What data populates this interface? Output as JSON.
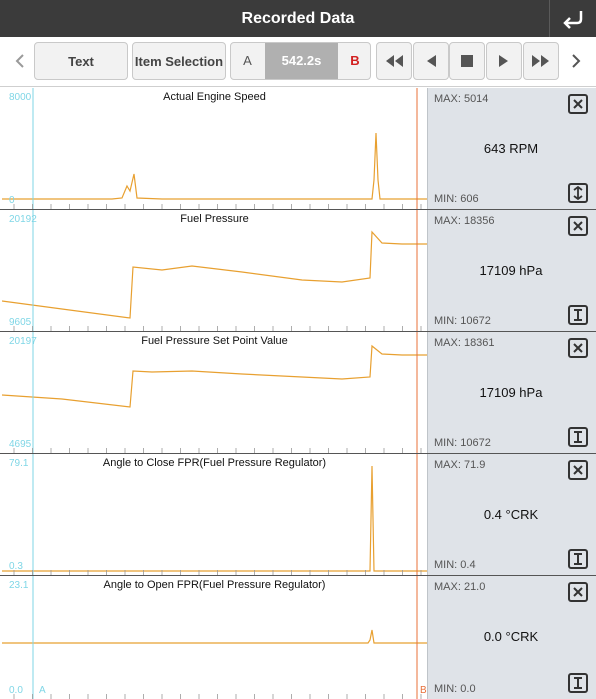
{
  "title_bar": {
    "title": "Recorded Data",
    "back_icon": "return-arrow-icon"
  },
  "toolbar": {
    "prev_icon": "chevron-left-icon",
    "text_label": "Text",
    "item_selection_label": "Item Selection",
    "cursor_a_label": "A",
    "time_value": "542.2s",
    "cursor_b_label": "B",
    "controls": [
      "rewind-icon",
      "step-back-icon",
      "stop-icon",
      "play-icon",
      "fast-forward-icon"
    ],
    "next_icon": "chevron-right-icon"
  },
  "colors": {
    "trace": "#e8a030",
    "cursor_a": "#7fd6e6",
    "cursor_b": "#e8703a",
    "stats_bg": "#dfe3e8",
    "title_bar": "#3b3b3b"
  },
  "panels": [
    {
      "title": "Actual Engine Speed",
      "y_max": "8000",
      "y_min": "0",
      "max": "MAX: 5014",
      "value": "643 RPM",
      "min": "MIN: 606",
      "top_icon": "close-icon",
      "bottom_icon": "expand-vertical-icon"
    },
    {
      "title": "Fuel Pressure",
      "y_max": "20192",
      "y_min": "9605",
      "max": "MAX: 18356",
      "value": "17109 hPa",
      "min": "MIN: 10672",
      "top_icon": "close-icon",
      "bottom_icon": "text-cursor-icon"
    },
    {
      "title": "Fuel Pressure Set Point Value",
      "y_max": "20197",
      "y_min": "4695",
      "max": "MAX: 18361",
      "value": "17109 hPa",
      "min": "MIN: 10672",
      "top_icon": "close-icon",
      "bottom_icon": "text-cursor-icon"
    },
    {
      "title": "Angle to Close FPR(Fuel Pressure Regulator)",
      "y_max": "79.1",
      "y_min": "0.3",
      "max": "MAX: 71.9",
      "value": "0.4 °CRK",
      "min": "MIN: 0.4",
      "top_icon": "close-icon",
      "bottom_icon": "text-cursor-icon"
    },
    {
      "title": "Angle to Open FPR(Fuel Pressure Regulator)",
      "y_max": "23.1",
      "y_min": "0.0",
      "max": "MAX: 21.0",
      "value": "0.0 °CRK",
      "min": "MIN: 0.0",
      "top_icon": "close-icon",
      "bottom_icon": "text-cursor-icon"
    }
  ],
  "cursor_labels": {
    "a": "A",
    "b": "B"
  }
}
